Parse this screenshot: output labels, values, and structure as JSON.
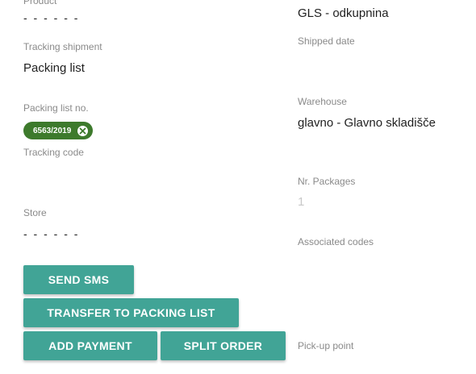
{
  "left": {
    "product": {
      "label": "Product",
      "value": "- - - - - -"
    },
    "tracking_shipment": {
      "label": "Tracking shipment",
      "value": "Packing list"
    },
    "packing_list_no": {
      "label": "Packing list no.",
      "chip": "6563/2019"
    },
    "tracking_code": {
      "label": "Tracking code",
      "value": ""
    },
    "store": {
      "label": "Store",
      "value": "- - - - - -"
    }
  },
  "right": {
    "shipping": {
      "value": "GLS - odkupnina"
    },
    "shipped_date": {
      "label": "Shipped date",
      "value": ""
    },
    "warehouse": {
      "label": "Warehouse",
      "value": "glavno - Glavno skladišče"
    },
    "nr_packages": {
      "label": "Nr. Packages",
      "value": "1"
    },
    "associated_codes": {
      "label": "Associated codes",
      "value": ""
    },
    "pickup_point": {
      "label": "Pick-up point",
      "value": ""
    }
  },
  "buttons": {
    "send_sms": "SEND SMS",
    "transfer_to_packing_list": "TRANSFER TO PACKING LIST",
    "add_payment": "ADD PAYMENT",
    "split_order": "SPLIT ORDER"
  },
  "colors": {
    "button": "#41a496",
    "chip": "#3d7a2c"
  }
}
